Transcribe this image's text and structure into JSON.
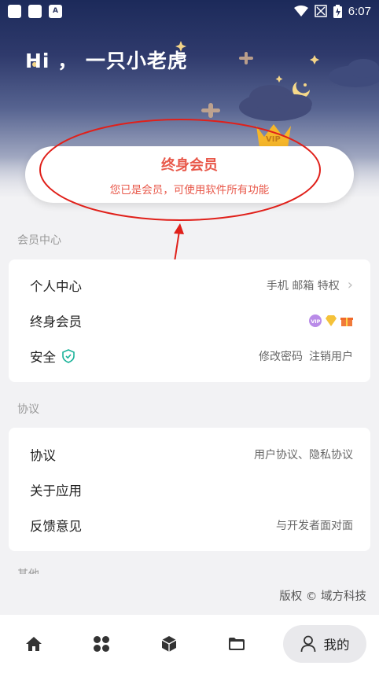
{
  "status_bar": {
    "time": "6:07"
  },
  "header": {
    "greeting": "Hi ， 一只小老虎"
  },
  "vip_card": {
    "title": "终身会员",
    "subtitle": "您已是会员，可使用软件所有功能"
  },
  "sections": {
    "member_center": {
      "label": "会员中心",
      "rows": [
        {
          "label": "个人中心",
          "value": "手机 邮箱 特权"
        },
        {
          "label": "终身会员",
          "value": ""
        },
        {
          "label": "安全",
          "value_a": "修改密码",
          "value_b": "注销用户"
        }
      ]
    },
    "agreement": {
      "label": "协议",
      "rows": [
        {
          "label": "协议",
          "value": "用户协议、隐私协议"
        },
        {
          "label": "关于应用",
          "value": ""
        },
        {
          "label": "反馈意见",
          "value": "与开发者面对面"
        }
      ]
    },
    "other": {
      "label": "其他"
    }
  },
  "copyright": "版权 © 域方科技",
  "bottom_nav": {
    "items": [
      {
        "icon": "home-icon"
      },
      {
        "icon": "grid-icon"
      },
      {
        "icon": "cube-icon"
      },
      {
        "icon": "folder-icon"
      }
    ],
    "active_label": "我的"
  },
  "colors": {
    "accent_red": "#e8584a",
    "shield_teal": "#1bb39a"
  }
}
